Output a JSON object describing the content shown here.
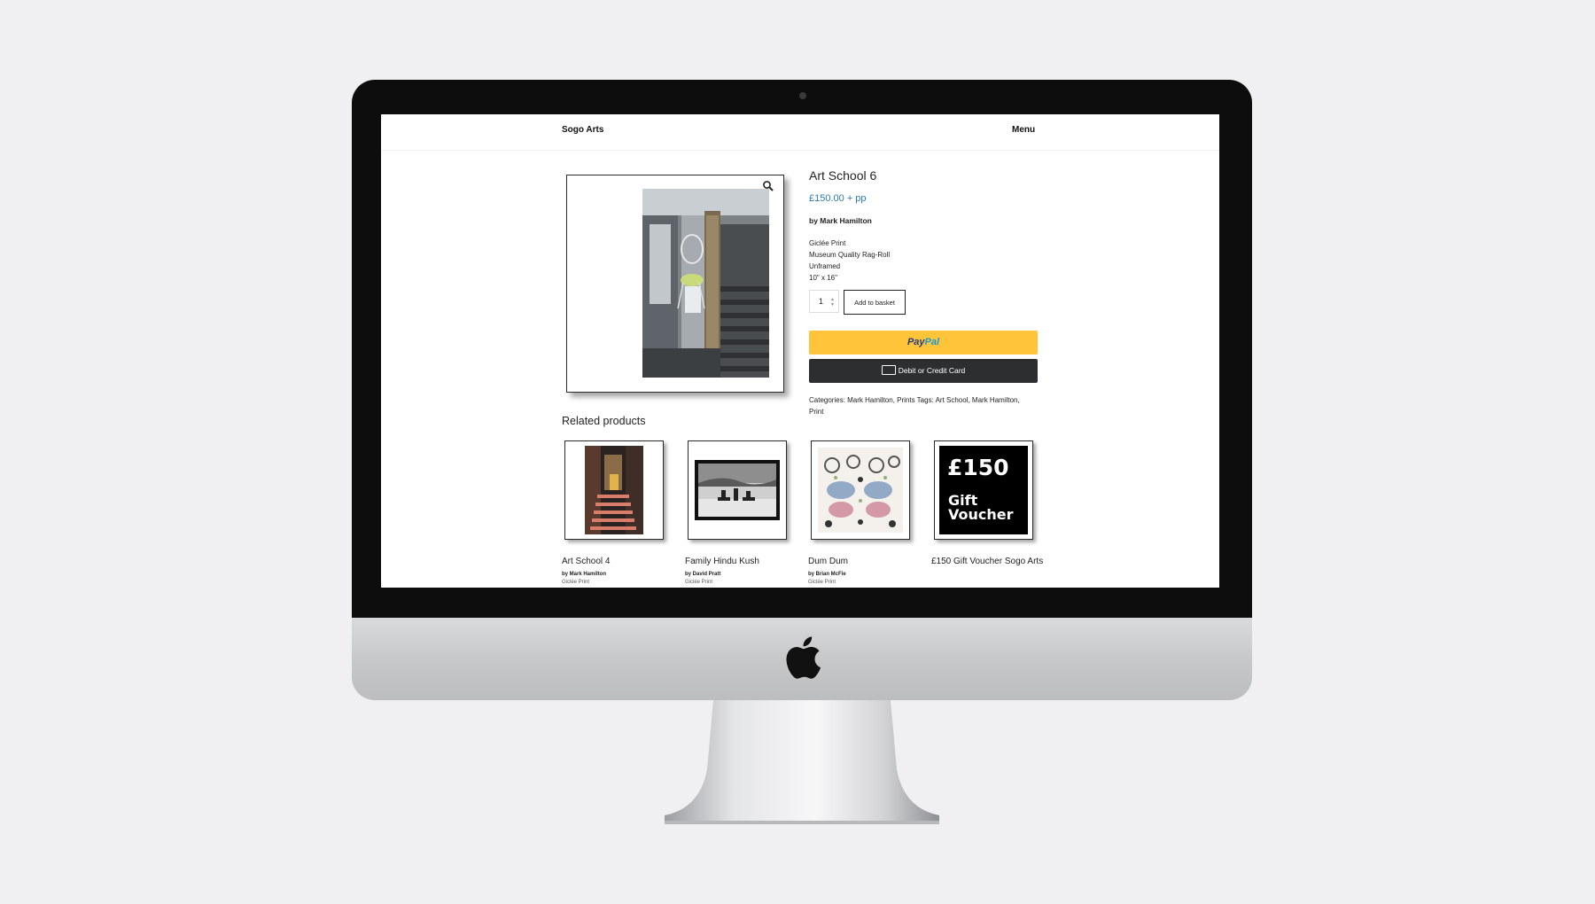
{
  "header": {
    "site_title": "Sogo Arts",
    "menu_label": "Menu"
  },
  "product": {
    "title": "Art School 6",
    "price": "£150.00 + pp",
    "byline": "by Mark Hamilton",
    "description": [
      "Giclée Print",
      "Museum Quality Rag-Roll",
      "Unframed",
      "10\" x 16\""
    ],
    "quantity": "1",
    "add_to_basket": "Add to basket",
    "paypal": {
      "pay": "Pay",
      "pal": "Pal"
    },
    "card_button": "Debit or Credit Card",
    "categories_line": "Categories: Mark Hamilton, Prints Tags: Art School, Mark Hamilton, Print"
  },
  "related": {
    "heading": "Related products",
    "items": [
      {
        "name": "Art School 4",
        "by": "by Mark Hamilton",
        "type": "Giclée Print"
      },
      {
        "name": "Family Hindu Kush",
        "by": "by David Pratt",
        "type": "Giclée Print"
      },
      {
        "name": "Dum Dum",
        "by": "by Brian McFie",
        "type": "Giclée Print"
      },
      {
        "name": "£150 Gift Voucher Sogo Arts",
        "by": "",
        "type": ""
      }
    ],
    "voucher": {
      "amount": "£150",
      "line1": "Gift",
      "line2": "Voucher"
    }
  },
  "colors": {
    "price": "#2a7ab8",
    "paypal_yellow": "#ffc439",
    "card_dark": "#2c2e2f"
  },
  "icons": [
    "zoom-icon",
    "apple-logo-icon",
    "card-icon"
  ]
}
